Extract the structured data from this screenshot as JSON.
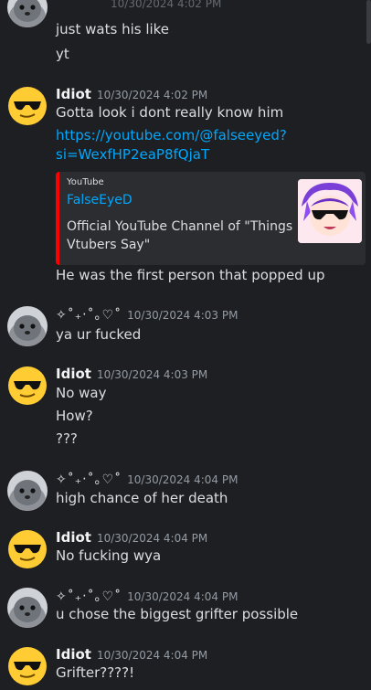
{
  "top_partial": {
    "timestamp": "10/30/2024 4:02 PM",
    "lines": [
      "just wats his like",
      "yt"
    ]
  },
  "messages": [
    {
      "author": "Idiot",
      "timestamp": "10/30/2024 4:02 PM",
      "lines": [
        "Gotta look i dont really know him"
      ],
      "link_lines": [
        "https://youtube.com/@falseeyed?",
        "si=WexfHP2eaP8fQjaT"
      ],
      "embed": {
        "provider": "YouTube",
        "title": "FalseEyeD",
        "description_lines": [
          "Official YouTube Channel of \"Things",
          "Vtubers Say\""
        ]
      },
      "after_lines": [
        "He was the first person that popped up"
      ]
    },
    {
      "author": "✧˚₊‧˚｡♡˚",
      "timestamp": "10/30/2024 4:03 PM",
      "lines": [
        "ya ur fucked"
      ]
    },
    {
      "author": "Idiot",
      "timestamp": "10/30/2024 4:03 PM",
      "lines": [
        "No way",
        "How?",
        "???"
      ]
    },
    {
      "author": "✧˚₊‧˚｡♡˚",
      "timestamp": "10/30/2024 4:04 PM",
      "lines": [
        "high chance of her death"
      ]
    },
    {
      "author": "Idiot",
      "timestamp": "10/30/2024 4:04 PM",
      "lines": [
        "No fucking wya"
      ]
    },
    {
      "author": "✧˚₊‧˚｡♡˚",
      "timestamp": "10/30/2024 4:04 PM",
      "lines": [
        "u chose the biggest grifter possible"
      ]
    },
    {
      "author": "Idiot",
      "timestamp": "10/30/2024 4:04 PM",
      "lines": [
        "Grifter????!"
      ]
    }
  ],
  "colors": {
    "background": "#1e1f22",
    "link": "#00a8fc",
    "timestamp": "#949ba4",
    "embed_bar": "#ff0000"
  }
}
